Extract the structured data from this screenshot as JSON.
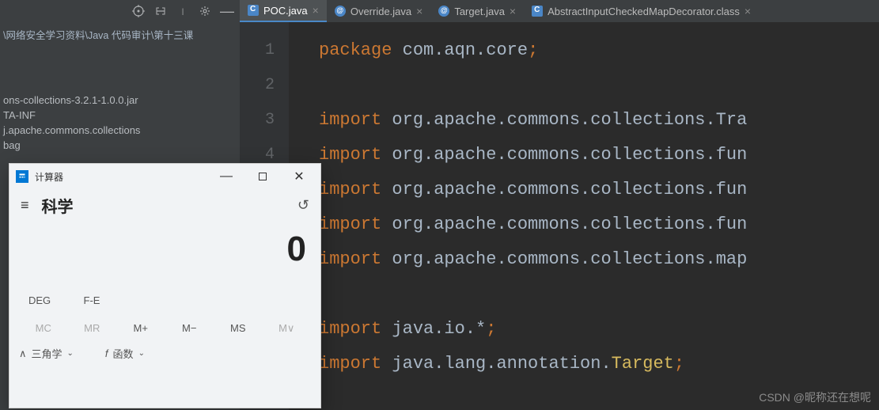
{
  "breadcrumb": "\\网络安全学习资料\\Java 代码审计\\第十三课",
  "tree": {
    "items": [
      "ons-collections-3.2.1-1.0.0.jar",
      "TA-INF",
      "j.apache.commons.collections",
      "bag"
    ]
  },
  "tabs": [
    {
      "label": "POC.java",
      "active": true,
      "type": "cls-blue"
    },
    {
      "label": "Override.java",
      "active": false,
      "type": "anno"
    },
    {
      "label": "Target.java",
      "active": false,
      "type": "anno"
    },
    {
      "label": "AbstractInputCheckedMapDecorator.class",
      "active": false,
      "type": "cls-blue"
    }
  ],
  "gutter": [
    "1",
    "2",
    "3",
    "4"
  ],
  "code": {
    "l1": {
      "kw": "package",
      "pkg": " com.aqn.core",
      "semi": ";"
    },
    "l3": {
      "kw": "import",
      "pkg": " org.apache.commons.collections.Tra"
    },
    "l4": {
      "kw": "import",
      "pkg": " org.apache.commons.collections.fun"
    },
    "l5": {
      "kw": "import",
      "pkg": " org.apache.commons.collections.fun"
    },
    "l6": {
      "kw": "import",
      "pkg": " org.apache.commons.collections.fun"
    },
    "l7": {
      "kw": "import",
      "pkg": " org.apache.commons.collections.map"
    },
    "l9": {
      "kw": "import",
      "pkg": " java.io.*",
      "semi": ";"
    },
    "l10": {
      "kw": "import",
      "pkg": " java.lang.annotation.",
      "cls": "Target",
      "semi": ";"
    }
  },
  "calc": {
    "title": "计算器",
    "mode": "科学",
    "display": "0",
    "row1": {
      "a": "DEG",
      "b": "F-E"
    },
    "mem": {
      "mc": "MC",
      "mr": "MR",
      "mp": "M+",
      "mm": "M−",
      "ms": "MS",
      "mv": "M∨"
    },
    "fn": {
      "trig": "三角学",
      "func": "函数",
      "caret": "∧",
      "fsym": "f"
    }
  },
  "watermark": "CSDN @昵称还在想呢"
}
